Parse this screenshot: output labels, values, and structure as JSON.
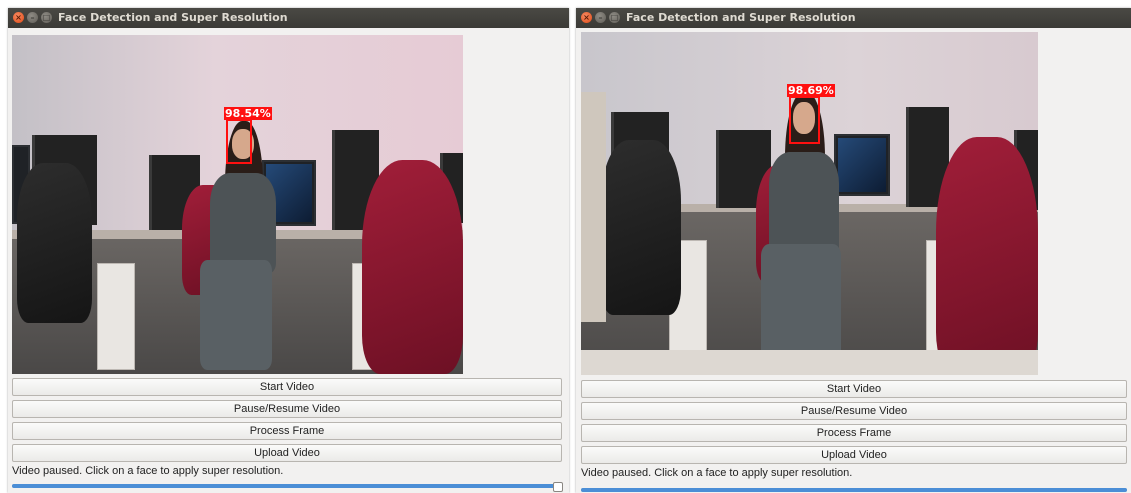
{
  "windows": [
    {
      "title": "Face Detection and Super Resolution",
      "detection": {
        "confidence_label": "98.54%"
      },
      "buttons": {
        "start_label": "Start Video",
        "pause_label": "Pause/Resume Video",
        "process_label": "Process Frame",
        "upload_label": "Upload Video"
      },
      "status_text": "Video paused. Click on a face to apply super resolution.",
      "progress": {
        "value_fraction": 0.995
      }
    },
    {
      "title": "Face Detection and Super Resolution",
      "detection": {
        "confidence_label": "98.69%"
      },
      "buttons": {
        "start_label": "Start Video",
        "pause_label": "Pause/Resume Video",
        "process_label": "Process Frame",
        "upload_label": "Upload Video"
      },
      "status_text": "Video paused. Click on a face to apply super resolution.",
      "progress": {
        "value_fraction": 1.0
      }
    }
  ],
  "colors": {
    "detection_box": "#ff1010",
    "progress_fill": "#4b8ed6",
    "titlebar": "#3b3a36",
    "close_button": "#df4a16"
  },
  "icons": [
    "close-icon",
    "minimize-icon",
    "maximize-icon"
  ]
}
